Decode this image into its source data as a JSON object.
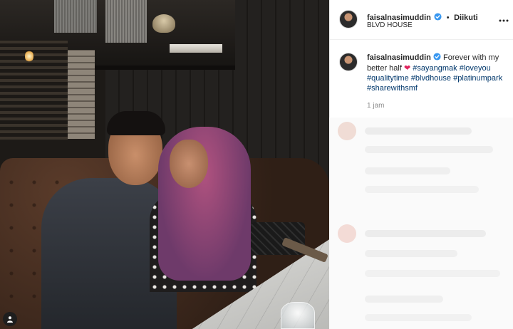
{
  "post": {
    "username": "faisalnasimuddin",
    "separator": "•",
    "follow_status": "Diikuti",
    "location": "BLVD HOUSE",
    "caption_prefix": "Forever with my better half",
    "heart": "❤",
    "hashtags": [
      "#sayangmak",
      "#loveyou",
      "#qualitytime",
      "#blvdhouse",
      "#platinumpark",
      "#sharewithsmf"
    ],
    "time_ago": "1 jam"
  },
  "icons": {
    "verified": "verified-badge-icon",
    "more": "more-options-icon",
    "tag": "tagged-user-icon",
    "heart": "heart-icon"
  },
  "colors": {
    "verified": "#3897f0",
    "hashtag": "#00376b",
    "heart": "#e0245e",
    "muted": "#8e8e8e"
  }
}
